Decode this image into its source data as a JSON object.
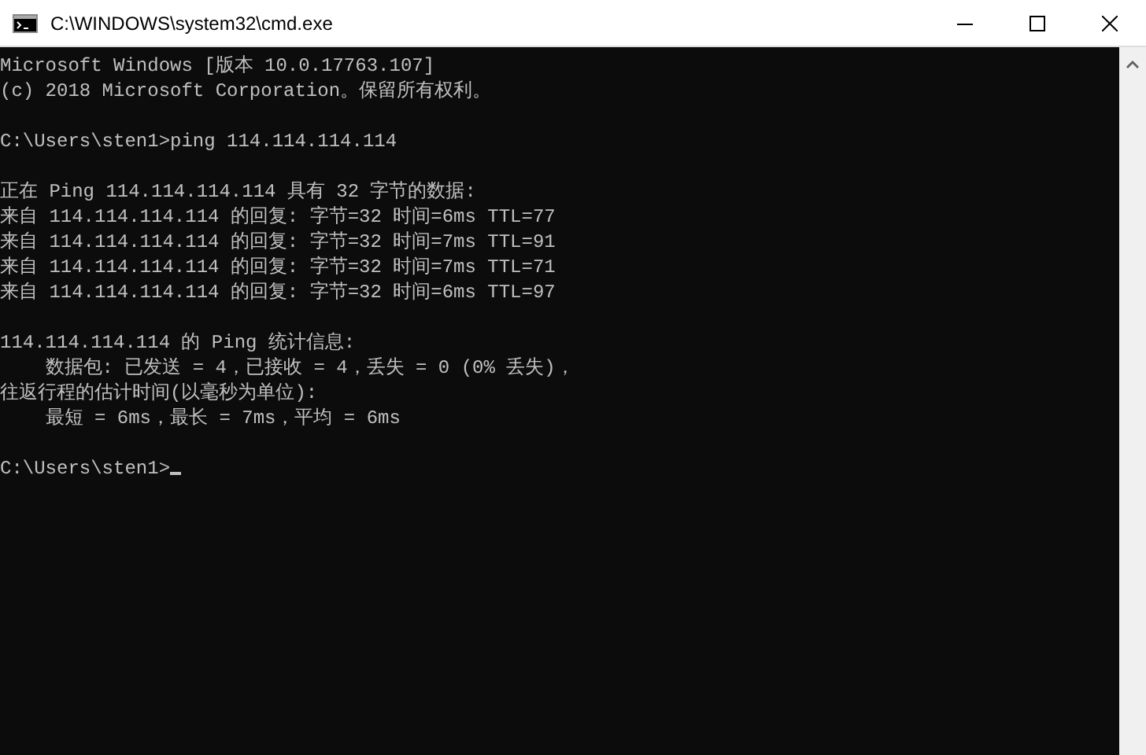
{
  "window": {
    "title": "C:\\WINDOWS\\system32\\cmd.exe"
  },
  "console": {
    "blocks": [
      [
        "Microsoft Windows [版本 10.0.17763.107]",
        "(c) 2018 Microsoft Corporation。保留所有权利。"
      ],
      [
        "C:\\Users\\sten1>ping 114.114.114.114"
      ],
      [
        "正在 Ping 114.114.114.114 具有 32 字节的数据:",
        "来自 114.114.114.114 的回复: 字节=32 时间=6ms TTL=77",
        "来自 114.114.114.114 的回复: 字节=32 时间=7ms TTL=91",
        "来自 114.114.114.114 的回复: 字节=32 时间=7ms TTL=71",
        "来自 114.114.114.114 的回复: 字节=32 时间=6ms TTL=97"
      ],
      [
        "114.114.114.114 的 Ping 统计信息:",
        "    数据包: 已发送 = 4，已接收 = 4，丢失 = 0 (0% 丢失)，",
        "往返行程的估计时间(以毫秒为单位):",
        "    最短 = 6ms，最长 = 7ms，平均 = 6ms"
      ]
    ],
    "prompt": {
      "text": "C:\\Users\\sten1>",
      "cursor": true
    }
  }
}
